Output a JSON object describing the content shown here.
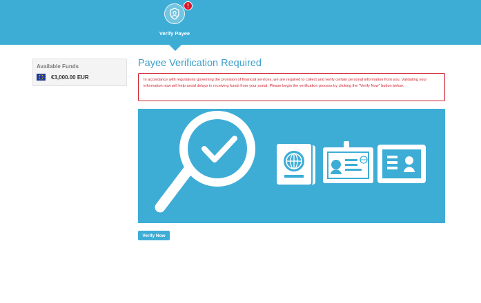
{
  "header": {
    "step_label": "Verify Payee",
    "alert_badge": "!"
  },
  "funds": {
    "title": "Available Funds",
    "amount": "€3,000.00 EUR"
  },
  "main": {
    "title": "Payee Verification Required",
    "notice": "In accordance with regulations governing the provision of financial services, we are required to collect and verify certain personal information from you. Validating your information now will help avoid delays in receiving funds from your portal. Please begin the verification process by clicking the \"Verify Now\" button below.",
    "verify_button": "Verify Now"
  },
  "icons": {
    "step": "shield-user-icon",
    "currency": "eu-flag-icon",
    "hero": [
      "magnifier-check-icon",
      "passport-icon",
      "id-badge-icon",
      "id-card-icon"
    ]
  },
  "colors": {
    "brand": "#3dadd6",
    "title": "#3d9fca",
    "alert": "#cf1d2c"
  }
}
